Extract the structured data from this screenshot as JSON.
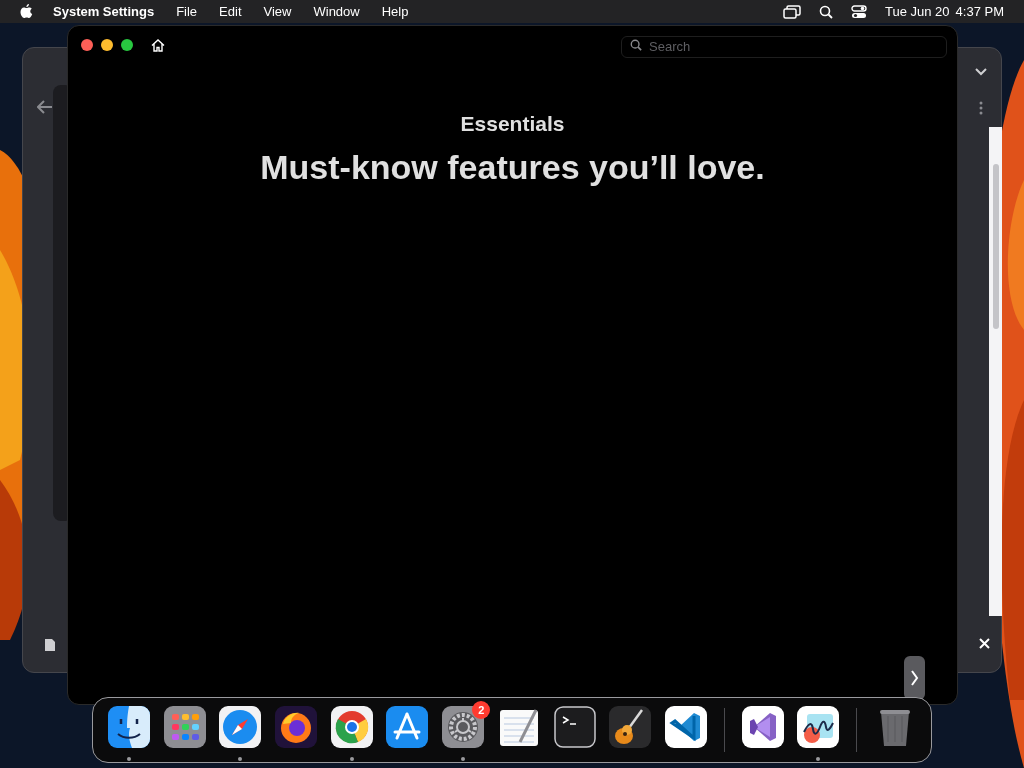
{
  "menu_bar": {
    "app_name": "System Settings",
    "menus": [
      "File",
      "Edit",
      "View",
      "Window",
      "Help"
    ],
    "date": "Tue Jun 20",
    "time": "4:37 PM"
  },
  "window": {
    "search": {
      "placeholder": "Search"
    },
    "eyebrow": "Essentials",
    "headline": "Must-know features you’ll love."
  },
  "dock": {
    "items": [
      {
        "kind": "app",
        "running": true
      },
      {
        "kind": "app",
        "running": false
      },
      {
        "kind": "app",
        "running": true
      },
      {
        "kind": "app",
        "running": false
      },
      {
        "kind": "app",
        "running": true
      },
      {
        "kind": "app",
        "running": false
      },
      {
        "kind": "app",
        "running": true,
        "badge": "2"
      },
      {
        "kind": "app",
        "running": false
      },
      {
        "kind": "app",
        "running": false
      },
      {
        "kind": "app",
        "running": false
      },
      {
        "kind": "app",
        "running": false
      },
      {
        "kind": "separator"
      },
      {
        "kind": "app",
        "running": false
      },
      {
        "kind": "app",
        "running": true
      },
      {
        "kind": "separator"
      },
      {
        "kind": "app",
        "running": false
      }
    ]
  }
}
